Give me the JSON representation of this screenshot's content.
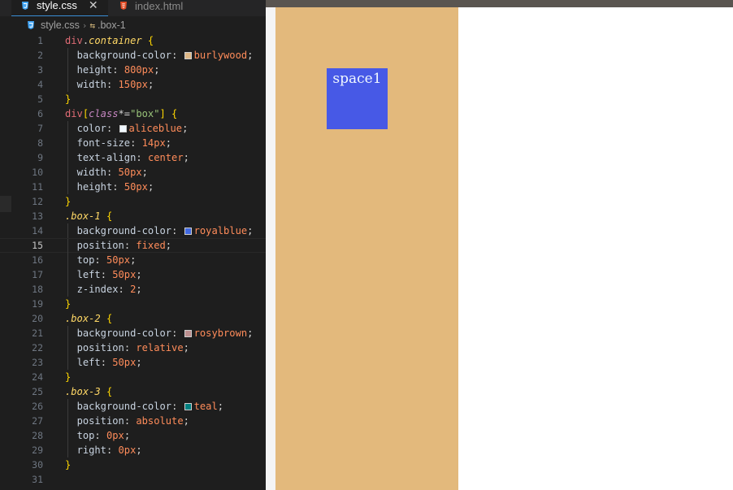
{
  "editor": {
    "tabs": [
      {
        "label": "style.css",
        "active": true,
        "close": "✕"
      },
      {
        "label": "index.html",
        "active": false
      }
    ],
    "breadcrumb": {
      "file": "style.css",
      "symbol": ".box-1"
    },
    "current_line": 15,
    "lines": [
      {
        "n": "1"
      },
      {
        "n": "2"
      },
      {
        "n": "3"
      },
      {
        "n": "4"
      },
      {
        "n": "5"
      },
      {
        "n": "6"
      },
      {
        "n": "7"
      },
      {
        "n": "8"
      },
      {
        "n": "9"
      },
      {
        "n": "10"
      },
      {
        "n": "11"
      },
      {
        "n": "12"
      },
      {
        "n": "13"
      },
      {
        "n": "14"
      },
      {
        "n": "15"
      },
      {
        "n": "16"
      },
      {
        "n": "17"
      },
      {
        "n": "18"
      },
      {
        "n": "19"
      },
      {
        "n": "20"
      },
      {
        "n": "21"
      },
      {
        "n": "22"
      },
      {
        "n": "23"
      },
      {
        "n": "24"
      },
      {
        "n": "25"
      },
      {
        "n": "26"
      },
      {
        "n": "27"
      },
      {
        "n": "28"
      },
      {
        "n": "29"
      },
      {
        "n": "30"
      },
      {
        "n": "31"
      }
    ],
    "code": {
      "l1_tag": "div",
      "l1_dot": ".",
      "l1_cls": "container",
      "l1_brace": " {",
      "l2_prop": "background-color",
      "l2_val": "burlywood",
      "l3_prop": "height",
      "l3_val": "800px",
      "l4_prop": "width",
      "l4_val": "150px",
      "l5": "}",
      "l6_tag": "div",
      "l6_open": "[",
      "l6_attr": "class",
      "l6_op": "*=",
      "l6_str": "\"box\"",
      "l6_close": "]",
      "l6_brace": " {",
      "l7_prop": "color",
      "l7_val": "aliceblue",
      "l8_prop": "font-size",
      "l8_val": "14px",
      "l9_prop": "text-align",
      "l9_val": "center",
      "l10_prop": "width",
      "l10_val": "50px",
      "l11_prop": "height",
      "l11_val": "50px",
      "l12": "}",
      "l13_sel": ".box-1",
      "l13_brace": " {",
      "l14_prop": "background-color",
      "l14_val": "royalblue",
      "l15_prop": "position",
      "l15_val": "fixed",
      "l16_prop": "top",
      "l16_val": "50px",
      "l17_prop": "left",
      "l17_val": "50px",
      "l18_prop": "z-index",
      "l18_val": "2",
      "l19": "}",
      "l20_sel": ".box-2",
      "l20_brace": " {",
      "l21_prop": "background-color",
      "l21_val": "rosybrown",
      "l22_prop": "position",
      "l22_val": "relative",
      "l23_prop": "left",
      "l23_val": "50px",
      "l24": "}",
      "l25_sel": ".box-3",
      "l25_brace": " {",
      "l26_prop": "background-color",
      "l26_val": "teal",
      "l27_prop": "position",
      "l27_val": "absolute",
      "l28_prop": "top",
      "l28_val": "0px",
      "l29_prop": "right",
      "l29_val": "0px",
      "l30": "}"
    },
    "colors": {
      "burlywood": "#deb887",
      "aliceblue": "#f0f8ff",
      "royalblue": "#4169e1",
      "rosybrown": "#bc8f8f",
      "teal": "#008080"
    }
  },
  "preview": {
    "box1_text": "space1",
    "colors": {
      "container": "#e3b97c",
      "box1": "#4759e6"
    }
  }
}
